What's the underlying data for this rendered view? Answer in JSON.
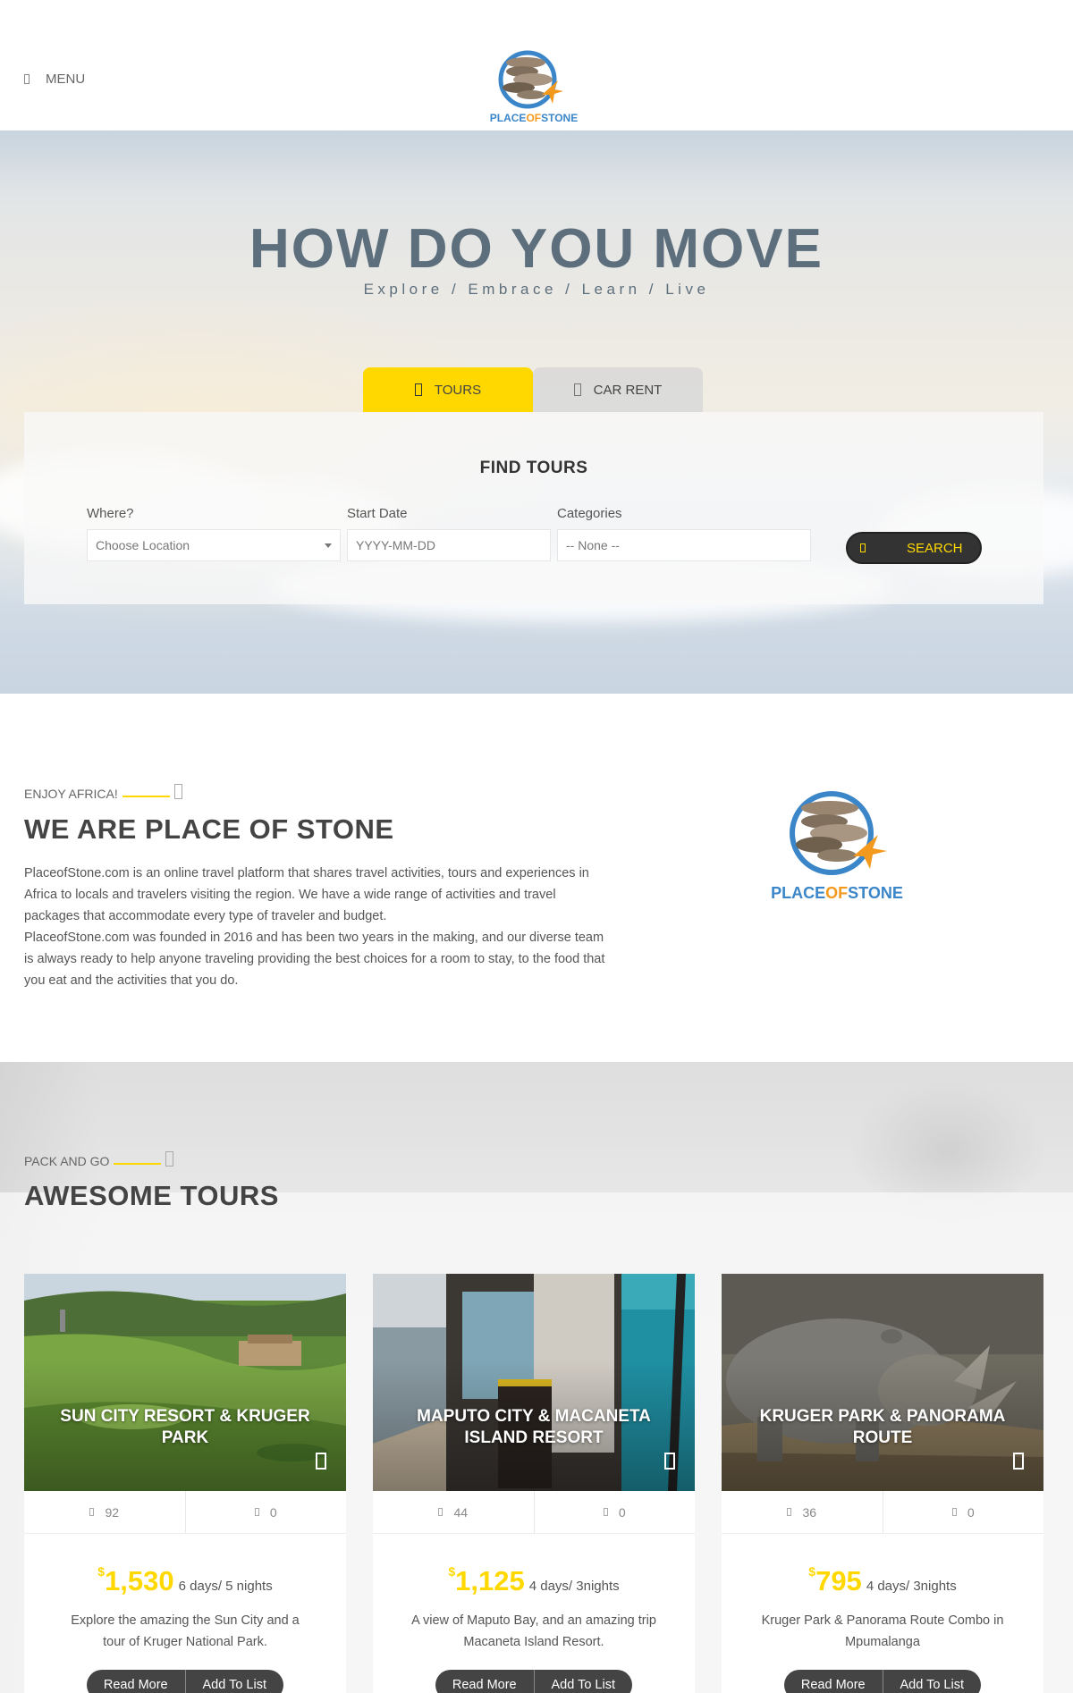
{
  "header": {
    "menu_label": "MENU",
    "logo_text_1": "PLACE",
    "logo_text_2": "OF",
    "logo_text_3": "STONE"
  },
  "hero": {
    "title": "HOW DO YOU MOVE",
    "subtitle": "Explore / Embrace / Learn / Live",
    "tabs": [
      {
        "label": "TOURS",
        "icon": "map-icon",
        "active": true
      },
      {
        "label": "CAR RENT",
        "icon": "car-icon",
        "active": false
      }
    ],
    "search": {
      "heading": "FIND TOURS",
      "where_label": "Where?",
      "where_value": "Choose Location",
      "date_label": "Start Date",
      "date_placeholder": "YYYY-MM-DD",
      "categories_label": "Categories",
      "categories_value": "-- None --",
      "button_label": "SEARCH"
    }
  },
  "about": {
    "kicker": "ENJOY AFRICA!",
    "title": "WE ARE PLACE OF STONE",
    "paragraph_1": "PlaceofStone.com is an online travel platform that shares travel activities, tours and experiences in Africa to locals and travelers visiting the region. We have a wide range of activities and travel packages that accommodate every type of traveler and budget.",
    "paragraph_2": "PlaceofStone.com was founded in 2016 and has been two years in the making, and our diverse team is always ready to help anyone traveling providing the best choices for a room to stay, to the food that you eat and the activities that you do."
  },
  "tours": {
    "kicker": "PACK AND GO",
    "title": "AWESOME TOURS",
    "currency": "$",
    "read_more": "Read More",
    "add_to_list": "Add To List",
    "cards": [
      {
        "title": "SUN CITY RESORT & KRUGER PARK",
        "views": "92",
        "likes": "0",
        "price": "1,530",
        "duration": "6 days/ 5 nights",
        "description": "Explore the amazing the Sun City and a tour of Kruger National Park."
      },
      {
        "title": "MAPUTO CITY & MACANETA ISLAND RESORT",
        "views": "44",
        "likes": "0",
        "price": "1,125",
        "duration": "4 days/ 3nights",
        "description": "A view of Maputo Bay, and an amazing trip Macaneta Island Resort."
      },
      {
        "title": "KRUGER PARK & PANORAMA ROUTE",
        "views": "36",
        "likes": "0",
        "price": "795",
        "duration": "4 days/ 3nights",
        "description": "Kruger Park & Panorama Route Combo in Mpumalanga"
      }
    ]
  },
  "colors": {
    "accent": "#ffd800",
    "title": "#5d6f7c",
    "dark": "#444444",
    "logo_blue": "#3b86c8",
    "logo_orange": "#f39a1e"
  }
}
